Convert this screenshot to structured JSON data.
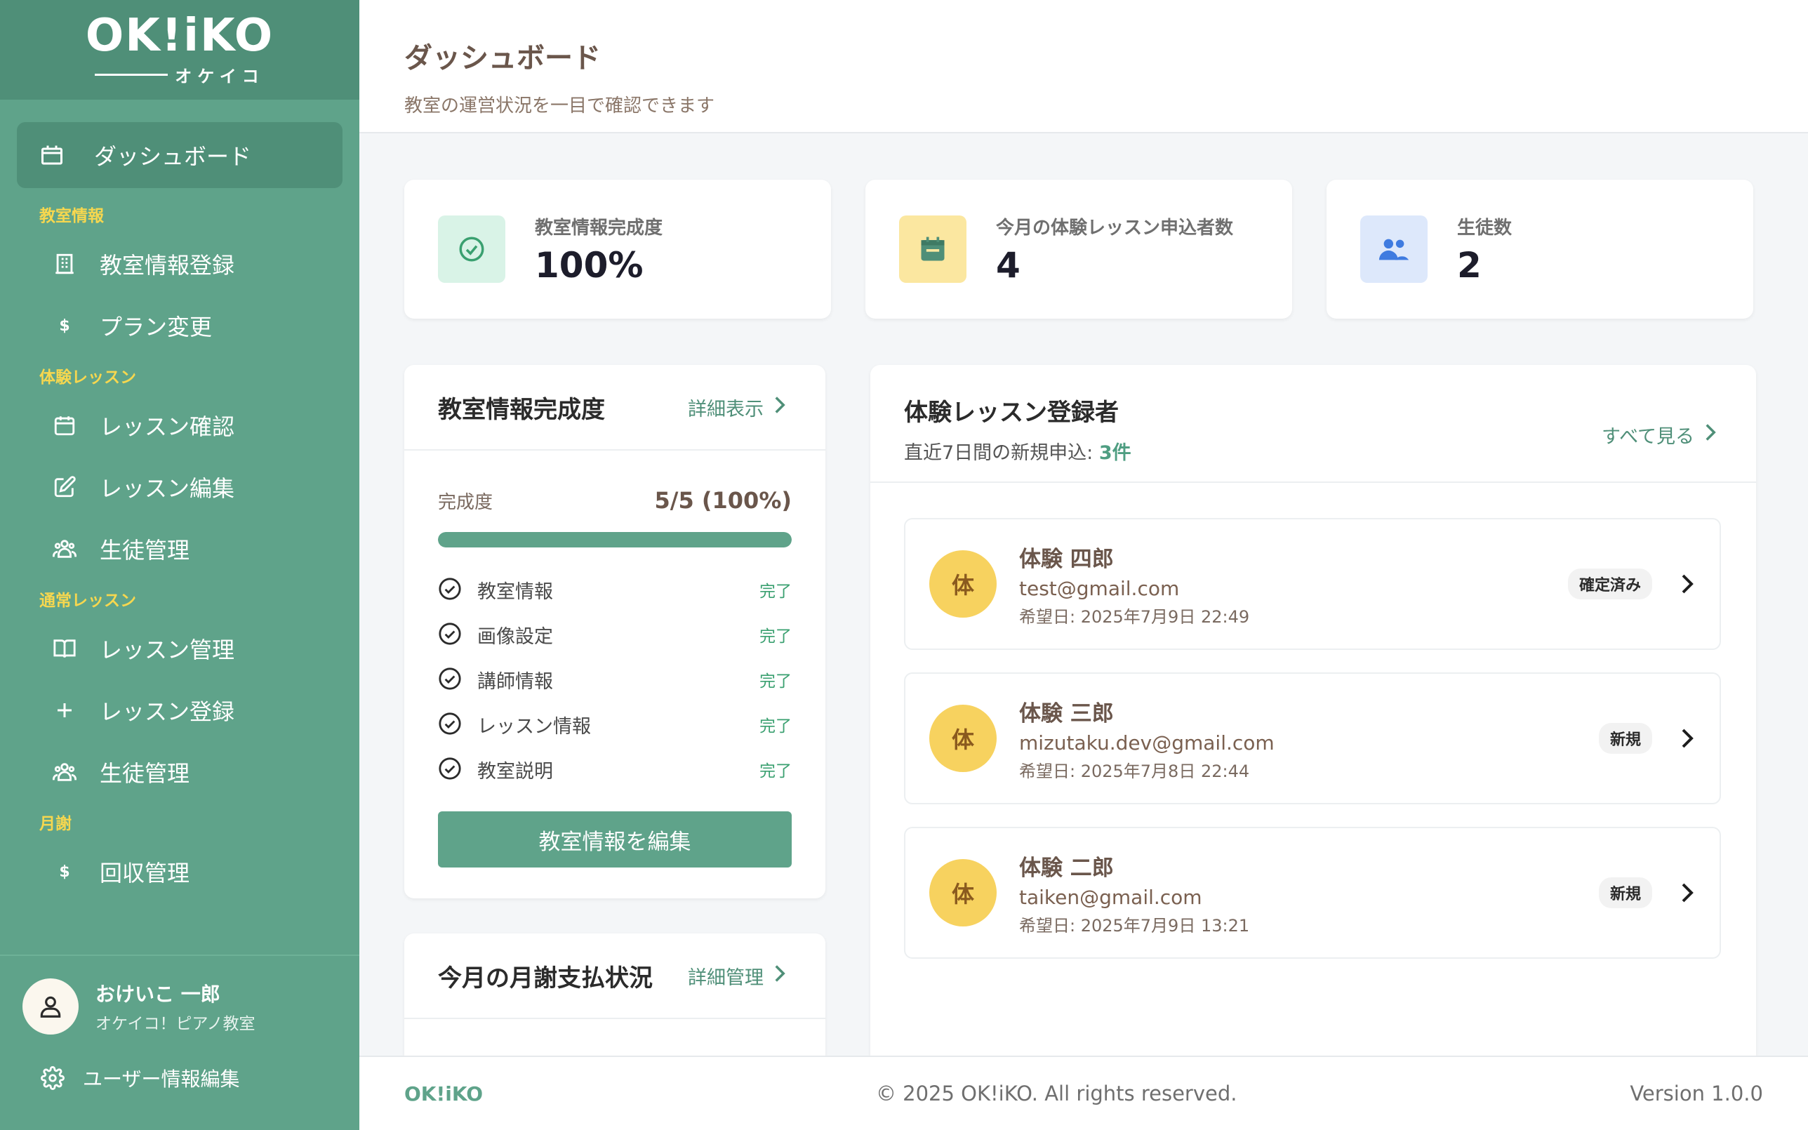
{
  "brand": {
    "logo": "OK!iKO",
    "logo_sub": "オケイコ"
  },
  "sidebar": {
    "dashboard": "ダッシュボード",
    "sections": {
      "classroom": "教室情報",
      "trial": "体験レッスン",
      "regular": "通常レッスン",
      "fees": "月謝"
    },
    "items": {
      "classroom_register": "教室情報登録",
      "plan_change": "プラン変更",
      "lesson_confirm": "レッスン確認",
      "lesson_edit": "レッスン編集",
      "trial_students": "生徒管理",
      "lesson_manage": "レッスン管理",
      "lesson_register": "レッスン登録",
      "regular_students": "生徒管理",
      "collection": "回収管理"
    },
    "dollar": "$",
    "user": {
      "name": "おけいこ 一郎",
      "school": "オケイコ！ピアノ教室",
      "edit": "ユーザー情報編集"
    }
  },
  "header": {
    "title": "ダッシュボード",
    "subtitle": "教室の運営状況を一目で確認できます"
  },
  "stats": [
    {
      "label": "教室情報完成度",
      "value": "100%",
      "color": "#3aa070"
    },
    {
      "label": "今月の体験レッスン申込者数",
      "value": "4",
      "color": "#f6d74f"
    },
    {
      "label": "生徒数",
      "value": "2",
      "color": "#3f7be0"
    }
  ],
  "completion": {
    "title": "教室情報完成度",
    "link": "詳細表示",
    "label": "完成度",
    "value": "5/5 (100%)",
    "progress": 1.0,
    "items": [
      {
        "label": "教室情報",
        "status": "完了"
      },
      {
        "label": "画像設定",
        "status": "完了"
      },
      {
        "label": "講師情報",
        "status": "完了"
      },
      {
        "label": "レッスン情報",
        "status": "完了"
      },
      {
        "label": "教室説明",
        "status": "完了"
      }
    ],
    "button": "教室情報を編集"
  },
  "payment": {
    "title": "今月の月謝支払状況",
    "link": "詳細管理"
  },
  "registrants": {
    "title": "体験レッスン登録者",
    "sub_label": "直近7日間の新規申込:",
    "sub_count": "3件",
    "link": "すべて見る",
    "items": [
      {
        "avatar": "体",
        "name": "体験 四郎",
        "email": "test@gmail.com",
        "date": "希望日: 2025年7月9日 22:49",
        "badge": "確定済み"
      },
      {
        "avatar": "体",
        "name": "体験 三郎",
        "email": "mizutaku.dev@gmail.com",
        "date": "希望日: 2025年7月8日 22:44",
        "badge": "新規"
      },
      {
        "avatar": "体",
        "name": "体験 二郎",
        "email": "taiken@gmail.com",
        "date": "希望日: 2025年7月9日 13:21",
        "badge": "新規"
      }
    ]
  },
  "footer": {
    "logo": "OK!iKO",
    "copyright": "© 2025 OK!iKO. All rights reserved.",
    "version": "Version 1.0.0"
  }
}
